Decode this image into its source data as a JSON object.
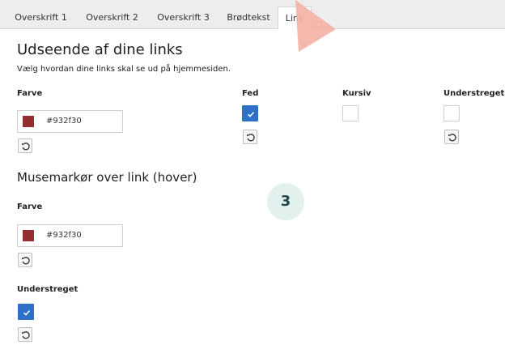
{
  "tabs": [
    {
      "label": "Overskrift 1"
    },
    {
      "label": "Overskrift 2"
    },
    {
      "label": "Overskrift 3"
    },
    {
      "label": "Brødtekst"
    },
    {
      "label": "Link",
      "active": true
    }
  ],
  "section1": {
    "title": "Udseende af dine links",
    "description": "Vælg hvordan dine links skal se ud på hjemmesiden.",
    "color_label": "Farve",
    "color_value": "#932f30",
    "bold_label": "Fed",
    "bold_checked": true,
    "italic_label": "Kursiv",
    "italic_checked": false,
    "underline_label": "Understreget",
    "underline_checked": false
  },
  "section2": {
    "title": "Musemarkør over link (hover)",
    "color_label": "Farve",
    "color_value": "#932f30",
    "underline_label": "Understreget",
    "underline_checked": true
  },
  "step_badge": "3",
  "colors": {
    "swatch": "#932f30",
    "checkbox_checked": "#2e6fc8",
    "pointer": "#f4b4a9",
    "badge_bg": "#e3f1ee"
  },
  "icons": {
    "reset": "reset-icon",
    "check": "check-icon",
    "pointer": "pointer-arrow-icon"
  }
}
